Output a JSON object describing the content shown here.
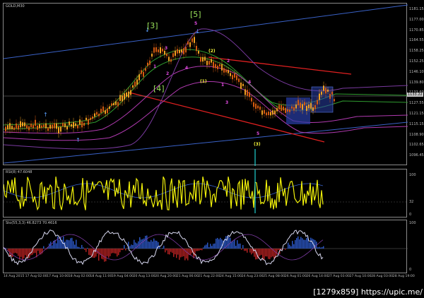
{
  "chart": {
    "symbol_label": "GOLD,M30",
    "osc1_label": "RSI(8) 47.6048",
    "osc2_label": "Sto(55,3,3) 46.8273 70.4616",
    "current_price": "1133.22",
    "price_ticks": [
      "1181.15",
      "1177.00",
      "1170.85",
      "1164.55",
      "1158.25",
      "1152.25",
      "1146.10",
      "1139.80",
      "1133.60",
      "1127.55",
      "1121.15",
      "1115.15",
      "1108.90",
      "1102.65",
      "1096.45"
    ],
    "osc1_ticks": [
      "100",
      "32",
      "0"
    ],
    "osc2_ticks": [
      "100",
      "0"
    ],
    "time_ticks": [
      "14 Aug 2015",
      "17 Aug 02:00",
      "17 Aug 10:00",
      "18 Aug 02:00",
      "18 Aug 11:00",
      "19 Aug 04:00",
      "20 Aug 13:00",
      "20 Aug 20:00",
      "21 Aug 06:00",
      "21 Aug 22:00",
      "24 Aug 15:00",
      "24 Aug 23:00",
      "25 Aug 08:00",
      "26 Aug 01:00",
      "26 Aug 14:00",
      "27 Aug 03:00",
      "27 Aug 10:00",
      "28 Aug 03:00",
      "28 Aug 19:00"
    ]
  },
  "waves": {
    "w3_big": "[3]",
    "w5_big": "[5]",
    "w4_big": "[4]",
    "w5_mag": "5",
    "w3_mag": "3",
    "w4_mag": "4",
    "w2_mag": "2",
    "w1_mag": "1",
    "w2_yel": "(2)",
    "w1_yel": "(1)",
    "w3_yel": "(3)",
    "c_mag1": "1",
    "c_mag2": "2",
    "c_mag3": "3",
    "c_mag4": "4",
    "c_mag5": "5"
  },
  "colors": {
    "trend_blue": "#3a62c8",
    "trend_red": "#e02020",
    "candle_bull": "#f2a020",
    "candle_bear": "#d45a10",
    "ma_green": "#2f9a2f",
    "ma_magenta": "#b03ab0",
    "rsi_yellow": "#f2f20a",
    "stoch_white": "#d8d8f0",
    "hist_blue": "#2a55c0",
    "hist_red": "#b02020"
  },
  "watermark": "[1279x859] https://upic.me/"
}
